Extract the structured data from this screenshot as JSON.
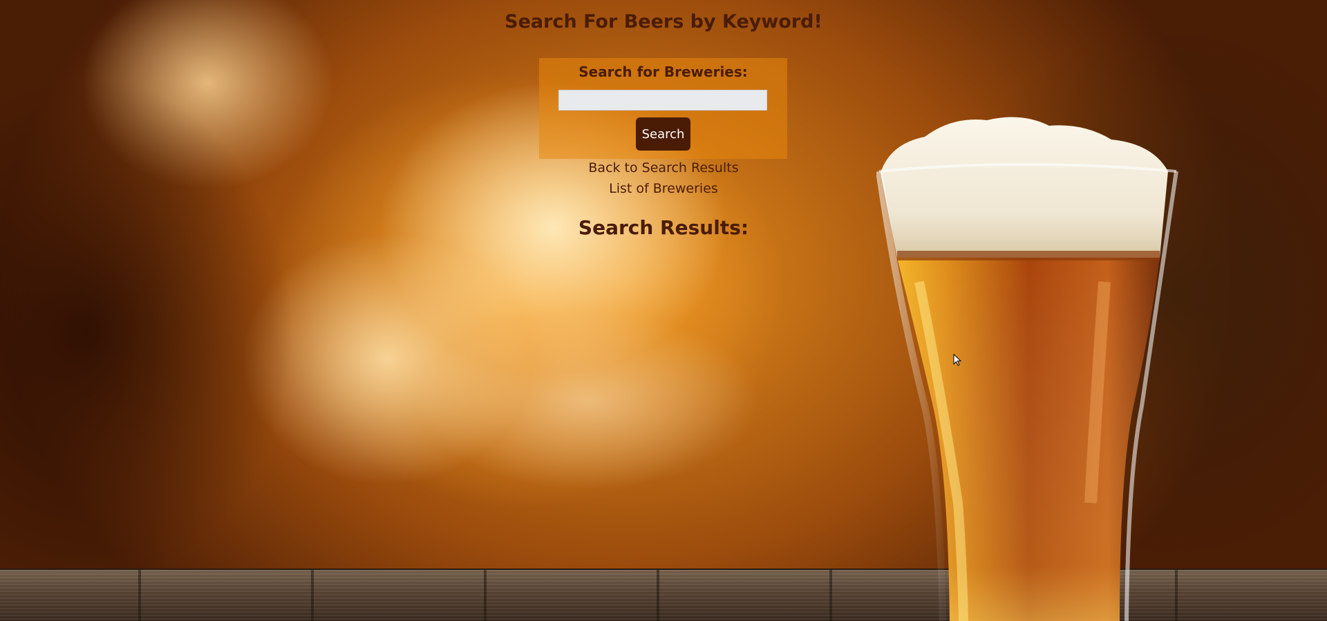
{
  "page": {
    "title": "Search For Beers by Keyword!"
  },
  "search": {
    "label": "Search for Breweries:",
    "input_value": "",
    "placeholder": "",
    "button_label": "Search"
  },
  "links": {
    "back_to_results": "Back to Search Results",
    "list_of_breweries": "List of Breweries"
  },
  "results": {
    "heading": "Search Results:",
    "items": []
  },
  "colors": {
    "text_brown": "#4a1c06",
    "panel_orange": "#e7870c",
    "button_bg": "#4a1c06",
    "button_text": "#ffffff",
    "input_bg": "#e8eaed"
  },
  "icons": {
    "background_image": "beer-glass-background-image",
    "cursor": "mouse-pointer-icon"
  }
}
